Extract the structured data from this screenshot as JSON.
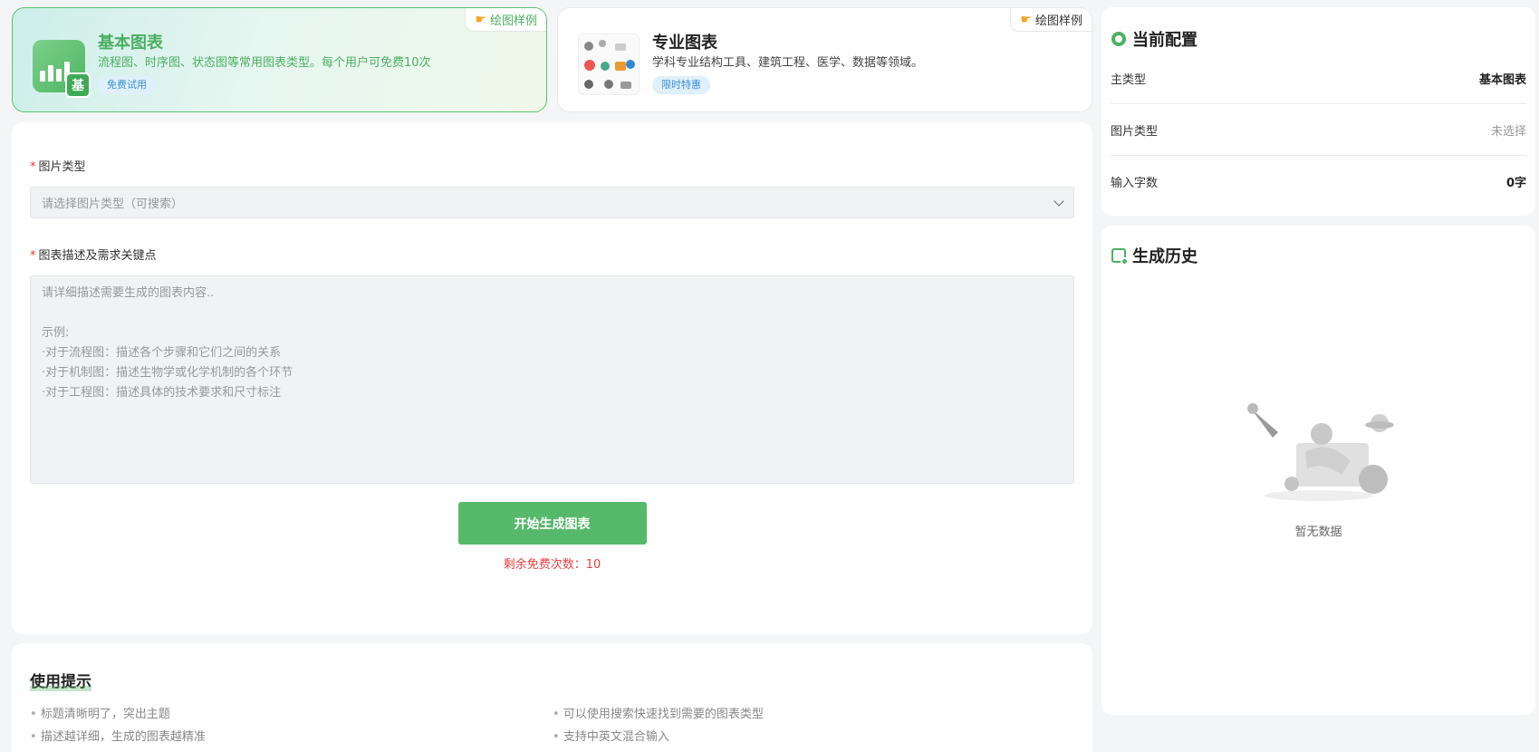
{
  "type_cards": [
    {
      "title": "基本图表",
      "desc": "流程图、时序图、状态图等常用图表类型。每个用户可免费10次",
      "badge": "免费试用",
      "sample_link": "绘图样例",
      "active": true,
      "icon_label": "基"
    },
    {
      "title": "专业图表",
      "desc": "学科专业结构工具、建筑工程、医学、数据等领域。",
      "badge": "限时特惠",
      "sample_link": "绘图样例",
      "active": false
    }
  ],
  "form": {
    "image_type_label": "图片类型",
    "image_type_placeholder": "请选择图片类型（可搜索）",
    "description_label": "图表描述及需求关键点",
    "description_placeholder": "请详细描述需要生成的图表内容..\n\n示例:\n·对于流程图：描述各个步骤和它们之间的关系\n·对于机制图：描述生物学或化学机制的各个环节\n·对于工程图：描述具体的技术要求和尺寸标注",
    "generate_button": "开始生成图表",
    "remaining_text": "剩余免费次数：10"
  },
  "tips": {
    "title": "使用提示",
    "items": [
      "标题清晰明了，突出主题",
      "可以使用搜索快速找到需要的图表类型",
      "描述越详细，生成的图表越精准",
      "支持中英文混合输入"
    ]
  },
  "config": {
    "title": "当前配置",
    "rows": [
      {
        "label": "主类型",
        "value": "基本图表"
      },
      {
        "label": "图片类型",
        "value": "未选择"
      },
      {
        "label": "输入字数",
        "value": "0字"
      }
    ]
  },
  "history": {
    "title": "生成历史",
    "empty_text": "暂无数据"
  },
  "colors": {
    "accent_green": "#56b86a",
    "remaining_red": "#e84040",
    "badge_blue": "#3d8fd1"
  }
}
